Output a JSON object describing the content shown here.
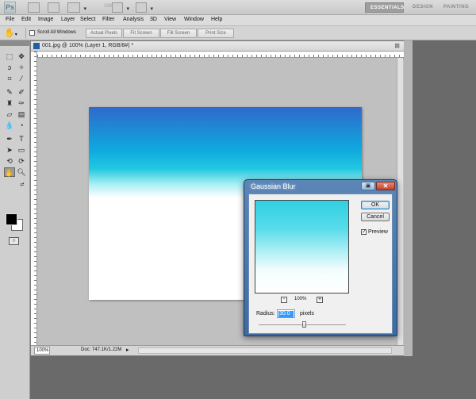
{
  "app": {
    "logo": "Ps",
    "zoom_level": "100%",
    "workspaces": [
      "ESSENTIALS",
      "DESIGN",
      "PAINTING"
    ],
    "active_workspace": "ESSENTIALS"
  },
  "menu": [
    "File",
    "Edit",
    "Image",
    "Layer",
    "Select",
    "Filter",
    "Analysis",
    "3D",
    "View",
    "Window",
    "Help"
  ],
  "options_bar": {
    "scroll_all_windows": "Scroll All Windows",
    "scroll_all_windows_checked": false,
    "buttons": [
      "Actual Pixels",
      "Fit Screen",
      "Fill Screen",
      "Print Size"
    ]
  },
  "tools": [
    "marquee-icon",
    "move-icon",
    "lasso-icon",
    "magic-wand-icon",
    "crop-icon",
    "eyedropper-icon",
    "healing-brush-icon",
    "brush-icon",
    "clone-stamp-icon",
    "history-brush-icon",
    "eraser-icon",
    "gradient-icon",
    "blur-icon",
    "dodge-icon",
    "pen-icon",
    "type-icon",
    "path-selection-icon",
    "shape-icon",
    "3d-rotate-icon",
    "3d-orbit-icon",
    "hand-icon",
    "zoom-icon"
  ],
  "colors": {
    "foreground": "#000000",
    "background": "#ffffff"
  },
  "document": {
    "title": "001.jpg @ 100% (Layer 1, RGB/8#) *",
    "status_zoom": "100%",
    "status_info": "Doc: 747.1K/1.22M"
  },
  "dialog": {
    "title": "Gaussian Blur",
    "ok_label": "OK",
    "cancel_label": "Cancel",
    "preview_label": "Preview",
    "preview_checked": true,
    "zoom_percent": "100%",
    "zoom_out": "-",
    "zoom_in": "+",
    "radius_label": "Radius:",
    "radius_value": "30.0",
    "radius_unit": "pixels"
  }
}
